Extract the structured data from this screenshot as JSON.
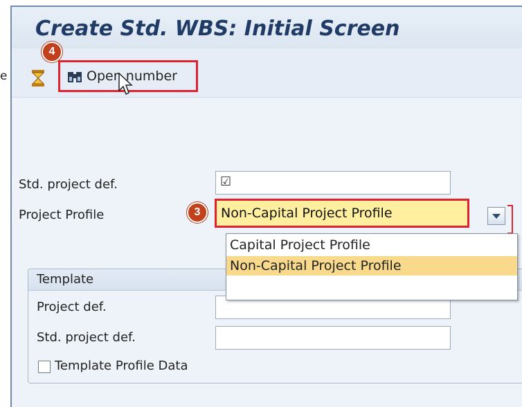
{
  "stray_fragment": "e",
  "window": {
    "title": "Create Std. WBS: Initial Screen"
  },
  "toolbar": {
    "open_number_label": "Open number"
  },
  "badges": {
    "step4": "4",
    "step3": "3"
  },
  "form": {
    "std_project_def_label": "Std. project def.",
    "std_project_def_value": "☑",
    "project_profile_label": "Project Profile",
    "project_profile_value": "Non-Capital Project Profile"
  },
  "dropdown": {
    "options": [
      "Capital Project Profile",
      "Non-Capital Project Profile"
    ],
    "selected": "Non-Capital Project Profile"
  },
  "template": {
    "title": "Template",
    "project_def_label": "Project def.",
    "std_project_def_label": "Std. project def.",
    "profile_data_label": "Template Profile Data",
    "profile_data_checked": false
  },
  "colors": {
    "highlight": "#e0212e",
    "badge": "#c0411b",
    "selection": "#f9d98b",
    "title": "#1f3b66"
  }
}
